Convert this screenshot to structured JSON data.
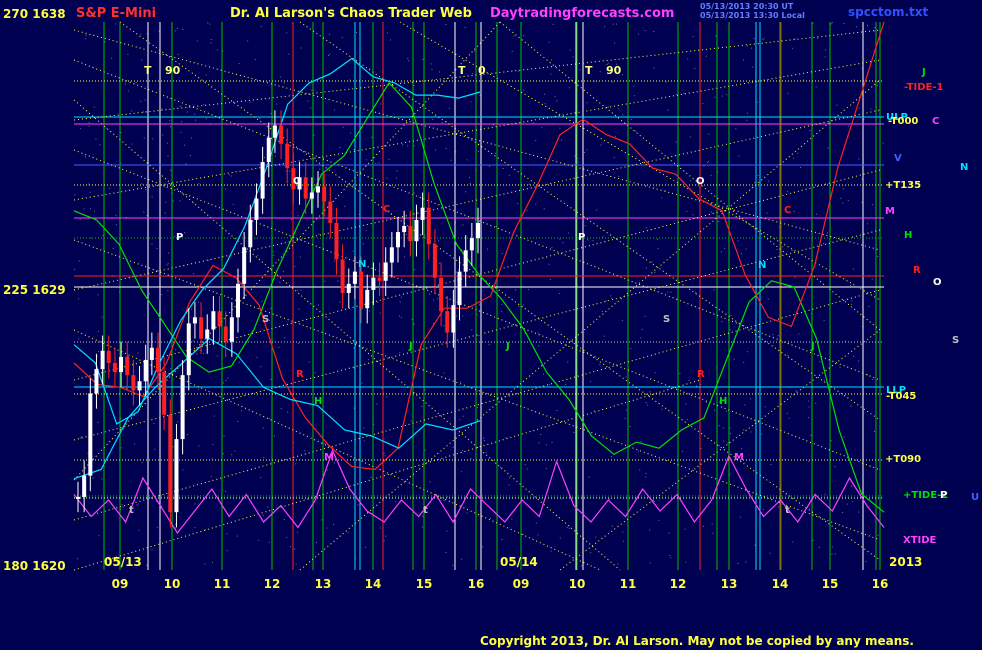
{
  "header": {
    "instrument": "S&P E-Mini",
    "title": "Dr. Al Larson's Chaos Trader Web",
    "site": "Daytradingforecasts.com",
    "timestamp_line1": "05/13/2013 20:30 UT",
    "timestamp_line2": "05/13/2013 13:30 Local",
    "filename": "spcctom.txt"
  },
  "left_axis": {
    "top": "270 1638",
    "mid": "225 1629",
    "bottom": "180 1620"
  },
  "footer": {
    "date_start": "05/13",
    "date_mid": "05/14",
    "year": "2013",
    "copyright": "Copyright 2013, Dr. Al Larson. May not be copied by any means."
  },
  "right_labels": [
    {
      "text": "J",
      "color": "#00e000"
    },
    {
      "text": "-TIDE-1",
      "color": "#ff2020"
    },
    {
      "text": "ULP",
      "color": "#00e0ff"
    },
    {
      "text": "-T000",
      "color": "#ffff40"
    },
    {
      "text": "C",
      "color": "#ff40ff"
    },
    {
      "text": "V",
      "color": "#4060ff"
    },
    {
      "text": "N",
      "color": "#00e0ff"
    },
    {
      "text": "+T135",
      "color": "#ffff40"
    },
    {
      "text": "M",
      "color": "#ff40ff"
    },
    {
      "text": "H",
      "color": "#00e000"
    },
    {
      "text": "R",
      "color": "#ff2020"
    },
    {
      "text": "O",
      "color": "#ffffff"
    },
    {
      "text": "S",
      "color": "#c0c0c0"
    },
    {
      "text": "LLP",
      "color": "#00e0ff"
    },
    {
      "text": "-T045",
      "color": "#ffff40"
    },
    {
      "text": "+T090",
      "color": "#ffff40"
    },
    {
      "text": "+TIDE-2",
      "color": "#00e000"
    },
    {
      "text": "P",
      "color": "#ffffff"
    },
    {
      "text": "U",
      "color": "#4060ff"
    },
    {
      "text": "XTIDE",
      "color": "#ff40ff"
    }
  ],
  "vertical_markers": [
    {
      "text": "T",
      "color": "#ffff80"
    },
    {
      "text": "90",
      "color": "#ffff80"
    },
    {
      "text": "T",
      "color": "#ffff80"
    },
    {
      "text": "0",
      "color": "#ffff80"
    },
    {
      "text": "T",
      "color": "#ffff80"
    },
    {
      "text": "90",
      "color": "#ffff80"
    }
  ],
  "plot_labels": [
    {
      "text": "O",
      "color": "#ffffff"
    },
    {
      "text": "P",
      "color": "#ffffff"
    },
    {
      "text": "C",
      "color": "#ff2020"
    },
    {
      "text": "N",
      "color": "#00e0ff"
    },
    {
      "text": "S",
      "color": "#c0c0c0"
    },
    {
      "text": "J",
      "color": "#00e000"
    },
    {
      "text": "R",
      "color": "#ff2020"
    },
    {
      "text": "H",
      "color": "#00e000"
    },
    {
      "text": "M",
      "color": "#ff40ff"
    },
    {
      "text": "t",
      "color": "#c0c0c0"
    },
    {
      "text": "t",
      "color": "#c0c0c0"
    },
    {
      "text": "J",
      "color": "#00e000"
    },
    {
      "text": "O",
      "color": "#ffffff"
    },
    {
      "text": "P",
      "color": "#ffffff"
    },
    {
      "text": "C",
      "color": "#ff2020"
    },
    {
      "text": "N",
      "color": "#00e0ff"
    },
    {
      "text": "S",
      "color": "#c0c0c0"
    },
    {
      "text": "J",
      "color": "#00e000"
    },
    {
      "text": "R",
      "color": "#ff2020"
    },
    {
      "text": "H",
      "color": "#00e000"
    },
    {
      "text": "M",
      "color": "#ff40ff"
    },
    {
      "text": "t",
      "color": "#c0c0c0"
    }
  ],
  "chart_data": {
    "type": "line",
    "title": "S&P E-Mini",
    "x_tick_labels": [
      "09",
      "10",
      "11",
      "12",
      "13",
      "14",
      "15",
      "16",
      "09",
      "10",
      "11",
      "12",
      "13",
      "14",
      "15",
      "16"
    ],
    "y_left_ticks": [
      {
        "angle": 270,
        "price": 1638
      },
      {
        "angle": 225,
        "price": 1629
      },
      {
        "angle": 180,
        "price": 1620
      }
    ],
    "ylim": [
      1620,
      1638
    ],
    "price_bars_close": [
      1622.4,
      1623.1,
      1625.8,
      1626.6,
      1627.2,
      1626.8,
      1626.5,
      1627.0,
      1626.4,
      1625.9,
      1626.2,
      1626.9,
      1627.3,
      1626.5,
      1625.1,
      1621.9,
      1624.3,
      1626.4,
      1628.1,
      1628.3,
      1627.6,
      1627.9,
      1628.5,
      1628.0,
      1627.5,
      1628.3,
      1629.4,
      1630.6,
      1631.5,
      1632.2,
      1633.4,
      1634.2,
      1634.6,
      1634.0,
      1633.2,
      1632.5,
      1632.9,
      1632.2,
      1632.4,
      1632.6,
      1632.1,
      1631.4,
      1630.2,
      1629.1,
      1629.4,
      1629.8,
      1628.6,
      1629.2,
      1629.6,
      1629.5,
      1630.1,
      1630.6,
      1631.1,
      1631.3,
      1630.8,
      1631.5,
      1631.9,
      1630.7,
      1629.6,
      1628.5,
      1627.8,
      1628.7,
      1629.8,
      1630.5,
      1630.9,
      1631.4
    ],
    "series": [
      {
        "name": "J",
        "color": "#00e000",
        "values": [
          1631.8,
          1631.5,
          1630.7,
          1629.2,
          1628.1,
          1627.0,
          1626.5,
          1626.7,
          1627.9,
          1629.8,
          1631.4,
          1633.0,
          1633.6,
          1634.8,
          1636.0,
          1635.2,
          1632.7,
          1630.7,
          1629.7,
          1628.9,
          1627.9,
          1626.5,
          1625.6,
          1624.4,
          1623.8,
          1624.2,
          1624.0,
          1624.6,
          1625.0,
          1626.9,
          1628.8,
          1629.5,
          1629.3,
          1627.6,
          1624.6,
          1622.5,
          1621.9
        ]
      },
      {
        "name": "R",
        "color": "#ff2020",
        "values": [
          1626.8,
          1626.1,
          1626.0,
          1625.7,
          1626.8,
          1628.8,
          1630.0,
          1629.6,
          1628.7,
          1626.3,
          1625.0,
          1624.1,
          1623.4,
          1623.3,
          1624.0,
          1627.4,
          1628.6,
          1628.6,
          1629.0,
          1631.1,
          1632.6,
          1634.3,
          1634.8,
          1634.3,
          1634.0,
          1633.2,
          1633.0,
          1632.2,
          1631.8,
          1629.7,
          1628.3,
          1628.0,
          1630.0,
          1633.2,
          1635.6,
          1638.0
        ]
      },
      {
        "name": "N",
        "color": "#00e0ff",
        "values": [
          1627.4,
          1626.8,
          1624.8,
          1625.2,
          1626.8,
          1628.2,
          1629.2,
          1629.9,
          1631.3,
          1633.2,
          1635.3,
          1636.0,
          1636.3,
          1636.8,
          1636.2,
          1636.0,
          1635.6,
          1635.6,
          1635.5,
          1635.7
        ]
      },
      {
        "name": "O",
        "color": "#00e0ff",
        "values": [
          1623.0,
          1623.3,
          1625.0,
          1626.0,
          1626.8,
          1627.6,
          1627.1,
          1626.0,
          1625.6,
          1625.4,
          1624.6,
          1624.4,
          1624.0,
          1624.8,
          1624.6,
          1624.9
        ]
      },
      {
        "name": "XTIDE",
        "color": "#ff40ff",
        "values": [
          0.55,
          0.35,
          0.5,
          0.3,
          0.7,
          0.45,
          0.2,
          0.4,
          0.6,
          0.35,
          0.55,
          0.3,
          0.45,
          0.25,
          0.5,
          0.95,
          0.6,
          0.4,
          0.3,
          0.5,
          0.35,
          0.55,
          0.3,
          0.6,
          0.45,
          0.3,
          0.5,
          0.35,
          0.85,
          0.45,
          0.3,
          0.5,
          0.35,
          0.6,
          0.4,
          0.55,
          0.3,
          0.5,
          0.9,
          0.6,
          0.35,
          0.5,
          0.3,
          0.55,
          0.4,
          0.7,
          0.45,
          0.25
        ]
      }
    ]
  }
}
